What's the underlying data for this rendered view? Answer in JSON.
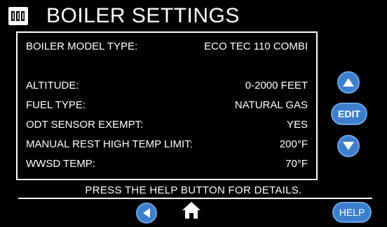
{
  "header": {
    "title": "BOILER SETTINGS",
    "logo_icon": "brand-logo-icon"
  },
  "settings": {
    "rows": [
      {
        "label": "BOILER MODEL TYPE:",
        "value": "ECO TEC 110 COMBI"
      },
      {
        "label": "ALTITUDE:",
        "value": "0-2000 FEET"
      },
      {
        "label": "FUEL TYPE:",
        "value": "NATURAL GAS"
      },
      {
        "label": "ODT SENSOR EXEMPT:",
        "value": "YES"
      },
      {
        "label": "MANUAL REST HIGH TEMP LIMIT:",
        "value": "200°F"
      },
      {
        "label": "WWSD TEMP:",
        "value": "70°F"
      }
    ]
  },
  "controls": {
    "up_icon": "arrow-up-icon",
    "edit_label": "EDIT",
    "down_icon": "arrow-down-icon"
  },
  "footer": {
    "help_text": "PRESS THE HELP BUTTON FOR DETAILS.",
    "back_icon": "arrow-left-icon",
    "home_icon": "home-icon",
    "help_label": "HELP"
  },
  "colors": {
    "background": "#000000",
    "accent_blue": "#3d7fcc",
    "text": "#ffffff"
  }
}
